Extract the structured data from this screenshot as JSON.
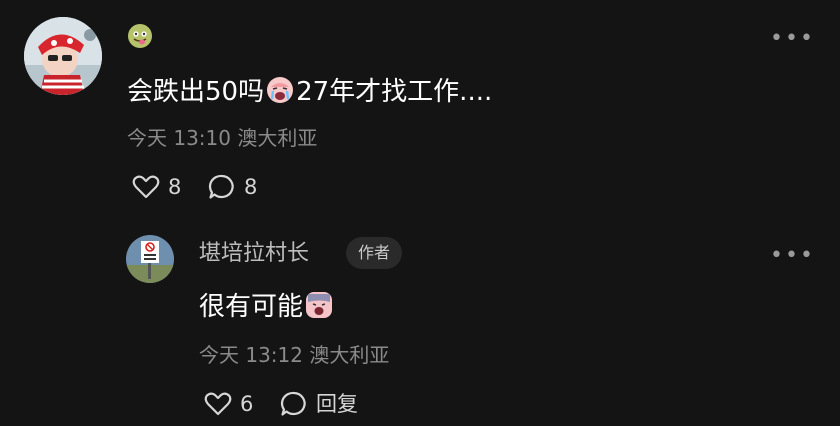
{
  "comment": {
    "text_part1": "会跌出50吗",
    "text_part2": "27年才找工作....",
    "emoji_name": "crying-face-emoji",
    "time_location": "今天 13:10  澳大利亚",
    "likes": "8",
    "replies": "8",
    "more_label": "•••"
  },
  "reply": {
    "username": "堪培拉村长",
    "author_badge": "作者",
    "text": "很有可能",
    "emoji_name": "scared-face-emoji",
    "time_location": "今天 13:12  澳大利亚",
    "likes": "6",
    "reply_label": "回复",
    "more_label": "•••"
  },
  "colors": {
    "background": "#141414",
    "text_primary": "#ffffff",
    "text_secondary": "#8a8a8a",
    "badge_bg": "#2a2a2a"
  }
}
